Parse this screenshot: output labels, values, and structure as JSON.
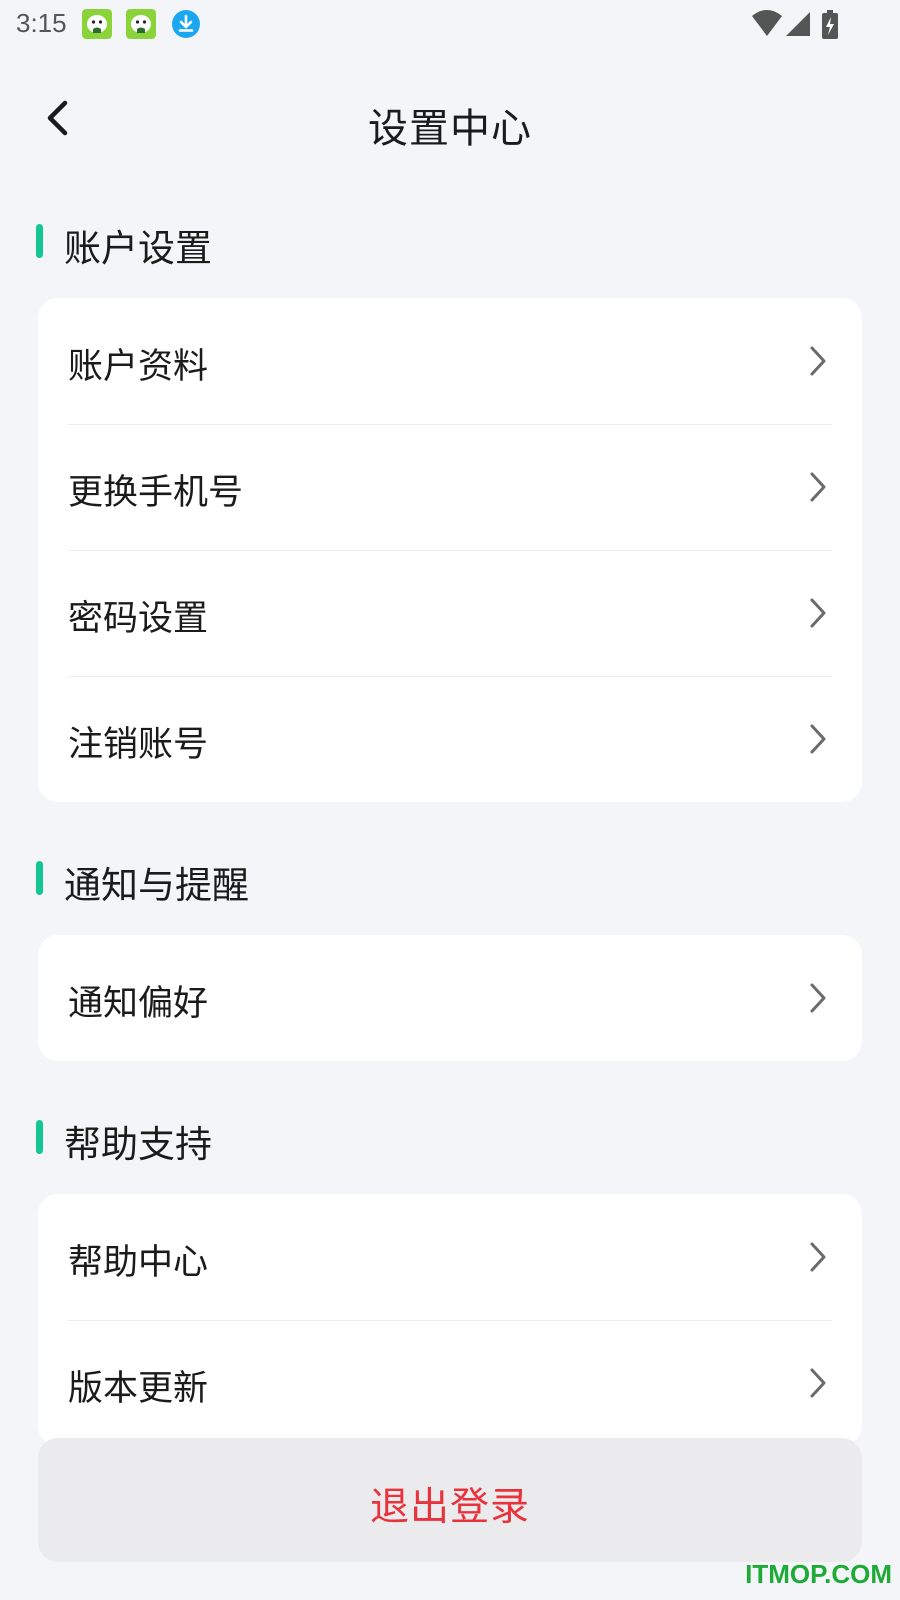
{
  "status_bar": {
    "time": "3:15",
    "notification_icons": [
      "app-mascot-icon",
      "app-mascot-icon",
      "download-icon"
    ],
    "right_icons": [
      "wifi-icon",
      "signal-icon",
      "battery-charging-icon"
    ]
  },
  "header": {
    "title": "设置中心",
    "back_icon": "chevron-left-icon"
  },
  "sections": [
    {
      "label": "账户设置",
      "items": [
        "账户资料",
        "更换手机号",
        "密码设置",
        "注销账号"
      ]
    },
    {
      "label": "通知与提醒",
      "items": [
        "通知偏好"
      ]
    },
    {
      "label": "帮助支持",
      "items": [
        "帮助中心",
        "版本更新"
      ]
    }
  ],
  "logout": {
    "label": "退出登录"
  },
  "watermark": "ITMOP.COM",
  "colors": {
    "accent": "#14c694",
    "background": "#f4f5f9",
    "danger": "#e9333c",
    "watermark": "#1faa37"
  }
}
